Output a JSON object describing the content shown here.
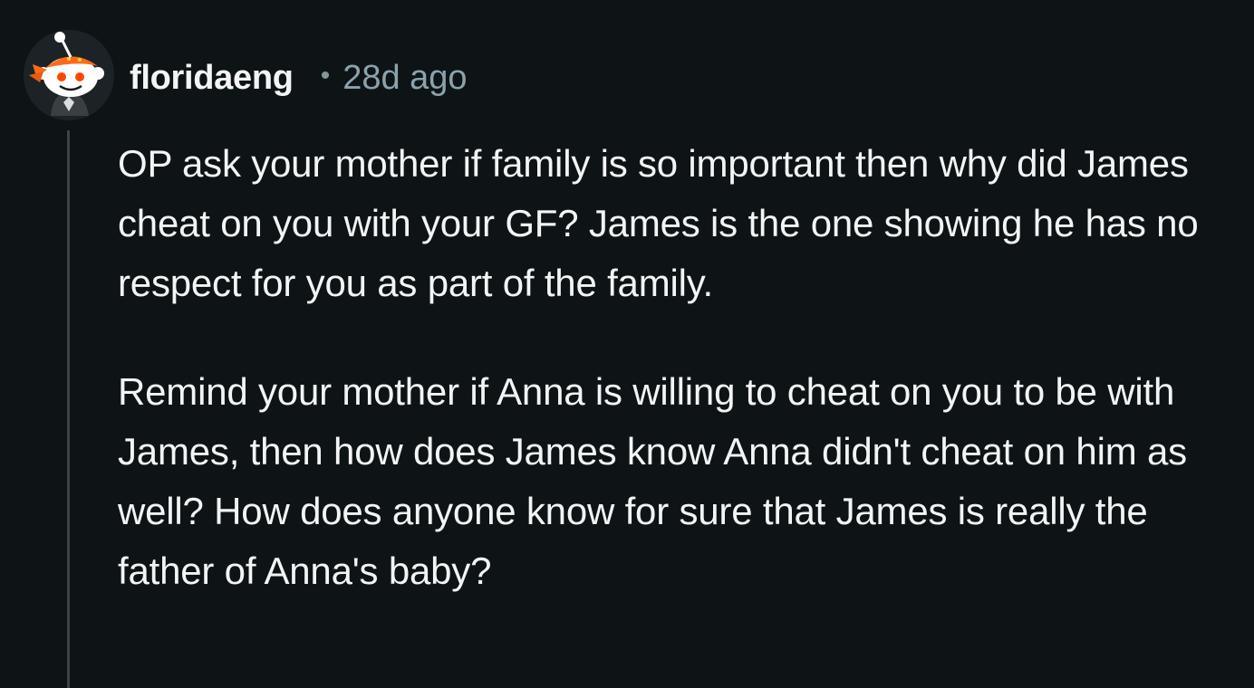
{
  "comment": {
    "username": "floridaeng",
    "separator": "•",
    "timestamp": "28d ago",
    "paragraphs": [
      "OP ask your mother if family is so important then why did James cheat on you with your GF? James is the one showing he has no respect for you as part of the family.",
      "Remind your mother if Anna is willing to cheat on you to be with James, then how does James know Anna didn't cheat on him as well? How does anyone know for sure that James is really the father of Anna's baby?"
    ]
  },
  "icons": {
    "avatar": "snoo-avatar-icon"
  },
  "colors": {
    "background": "#0e1416",
    "text": "#f2f4f5",
    "muted": "#8ba2ad",
    "thread_line": "#3b4447"
  }
}
